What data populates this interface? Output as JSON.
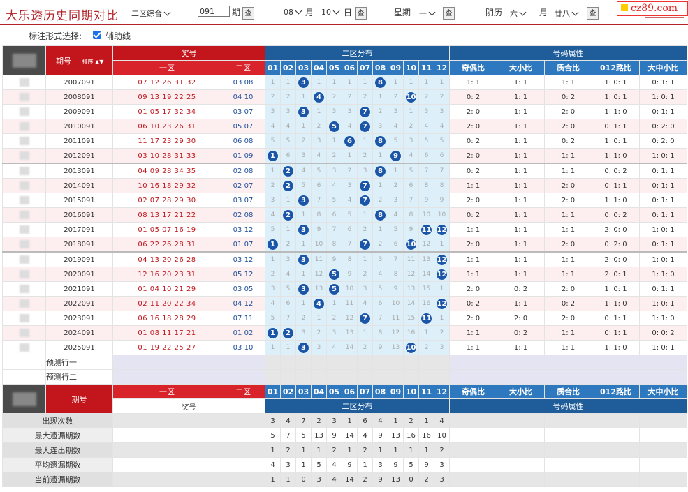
{
  "title": "大乐透历史同期对比",
  "controls": {
    "zone_select": "二区综合",
    "period_value": "091",
    "period_label": "期",
    "query_label": "查",
    "month_value": "08",
    "month_label": "月",
    "day_value": "10",
    "day_label": "日",
    "week_prefix": "星期",
    "week_value": "一",
    "lunar_prefix": "阴历",
    "lunar_month": "六",
    "lunar_month_label": "月",
    "lunar_day": "廿八"
  },
  "logo_text": "cz89.com",
  "options": {
    "label": "标注形式选择:",
    "checkbox_label": "辅助线",
    "checked": true
  },
  "header": {
    "issue": "期号",
    "sort": "排序",
    "prize": "奖号",
    "zone1": "一区",
    "zone2": "二区",
    "dist": "二区分布",
    "attr": "号码属性",
    "nums": [
      "01",
      "02",
      "03",
      "04",
      "05",
      "06",
      "07",
      "08",
      "09",
      "10",
      "11",
      "12"
    ],
    "attrs": [
      "奇偶比",
      "大小比",
      "质合比",
      "012路比",
      "大中小比"
    ]
  },
  "rows": [
    {
      "issue": "2007091",
      "z1": "07 12 26 31 32",
      "z2": "03 08",
      "dist": [
        "1",
        "1",
        "03",
        "1",
        "1",
        "1",
        "1",
        "08",
        "1",
        "1",
        "1",
        "1"
      ],
      "attr": [
        "1: 1",
        "1: 1",
        "1: 1",
        "1: 0: 1",
        "0: 1: 1"
      ]
    },
    {
      "issue": "2008091",
      "z1": "09 13 19 22 25",
      "z2": "04 10",
      "dist": [
        "2",
        "2",
        "1",
        "04",
        "2",
        "2",
        "2",
        "1",
        "2",
        "10",
        "2",
        "2"
      ],
      "attr": [
        "0: 2",
        "1: 1",
        "0: 2",
        "1: 0: 1",
        "1: 0: 1"
      ]
    },
    {
      "issue": "2009091",
      "z1": "01 05 17 32 34",
      "z2": "03 07",
      "dist": [
        "3",
        "3",
        "03",
        "1",
        "3",
        "3",
        "07",
        "2",
        "3",
        "1",
        "3",
        "3"
      ],
      "attr": [
        "2: 0",
        "1: 1",
        "2: 0",
        "1: 1: 0",
        "0: 1: 1"
      ]
    },
    {
      "issue": "2010091",
      "z1": "06 10 23 26 31",
      "z2": "05 07",
      "dist": [
        "4",
        "4",
        "1",
        "2",
        "05",
        "4",
        "07",
        "3",
        "4",
        "2",
        "4",
        "4"
      ],
      "attr": [
        "2: 0",
        "1: 1",
        "2: 0",
        "0: 1: 1",
        "0: 2: 0"
      ]
    },
    {
      "issue": "2011091",
      "z1": "11 17 23 29 30",
      "z2": "06 08",
      "dist": [
        "5",
        "5",
        "2",
        "3",
        "1",
        "06",
        "1",
        "08",
        "5",
        "3",
        "5",
        "5"
      ],
      "attr": [
        "0: 2",
        "1: 1",
        "0: 2",
        "1: 0: 1",
        "0: 2: 0"
      ]
    },
    {
      "issue": "2012091",
      "z1": "03 10 28 31 33",
      "z2": "01 09",
      "dist": [
        "01",
        "6",
        "3",
        "4",
        "2",
        "1",
        "2",
        "1",
        "09",
        "4",
        "6",
        "6"
      ],
      "attr": [
        "2: 0",
        "1: 1",
        "1: 1",
        "1: 1: 0",
        "1: 0: 1"
      ]
    },
    {
      "issue": "2013091",
      "z1": "04 09 28 34 35",
      "z2": "02 08",
      "dist": [
        "1",
        "02",
        "4",
        "5",
        "3",
        "2",
        "3",
        "08",
        "1",
        "5",
        "7",
        "7"
      ],
      "attr": [
        "0: 2",
        "1: 1",
        "1: 1",
        "0: 0: 2",
        "0: 1: 1"
      ]
    },
    {
      "issue": "2014091",
      "z1": "10 16 18 29 32",
      "z2": "02 07",
      "dist": [
        "2",
        "02",
        "5",
        "6",
        "4",
        "3",
        "07",
        "1",
        "2",
        "6",
        "8",
        "8"
      ],
      "attr": [
        "1: 1",
        "1: 1",
        "2: 0",
        "0: 1: 1",
        "0: 1: 1"
      ]
    },
    {
      "issue": "2015091",
      "z1": "02 07 28 29 30",
      "z2": "03 07",
      "dist": [
        "3",
        "1",
        "03",
        "7",
        "5",
        "4",
        "07",
        "2",
        "3",
        "7",
        "9",
        "9"
      ],
      "attr": [
        "2: 0",
        "1: 1",
        "2: 0",
        "1: 1: 0",
        "0: 1: 1"
      ]
    },
    {
      "issue": "2016091",
      "z1": "08 13 17 21 22",
      "z2": "02 08",
      "dist": [
        "4",
        "02",
        "1",
        "8",
        "6",
        "5",
        "1",
        "08",
        "4",
        "8",
        "10",
        "10"
      ],
      "attr": [
        "0: 2",
        "1: 1",
        "1: 1",
        "0: 0: 2",
        "0: 1: 1"
      ]
    },
    {
      "issue": "2017091",
      "z1": "01 05 07 16 19",
      "z2": "03 12",
      "dist": [
        "5",
        "1",
        "03",
        "9",
        "7",
        "6",
        "2",
        "1",
        "5",
        "9",
        "11",
        "12"
      ],
      "attr": [
        "1: 1",
        "1: 1",
        "1: 1",
        "2: 0: 0",
        "1: 0: 1"
      ]
    },
    {
      "issue": "2018091",
      "z1": "06 22 26 28 31",
      "z2": "01 07",
      "dist": [
        "01",
        "2",
        "1",
        "10",
        "8",
        "7",
        "07",
        "2",
        "6",
        "10",
        "12",
        "1"
      ],
      "attr": [
        "2: 0",
        "1: 1",
        "2: 0",
        "0: 2: 0",
        "0: 1: 1"
      ]
    },
    {
      "issue": "2019091",
      "z1": "04 13 20 26 28",
      "z2": "03 12",
      "dist": [
        "1",
        "3",
        "03",
        "11",
        "9",
        "8",
        "1",
        "3",
        "7",
        "11",
        "13",
        "12"
      ],
      "attr": [
        "1: 1",
        "1: 1",
        "1: 1",
        "2: 0: 0",
        "1: 0: 1"
      ]
    },
    {
      "issue": "2020091",
      "z1": "12 16 20 23 31",
      "z2": "05 12",
      "dist": [
        "2",
        "4",
        "1",
        "12",
        "05",
        "9",
        "2",
        "4",
        "8",
        "12",
        "14",
        "12"
      ],
      "attr": [
        "1: 1",
        "1: 1",
        "1: 1",
        "2: 0: 1",
        "1: 1: 0"
      ]
    },
    {
      "issue": "2021091",
      "z1": "01 04 10 21 29",
      "z2": "03 05",
      "dist": [
        "3",
        "5",
        "03",
        "13",
        "05",
        "10",
        "3",
        "5",
        "9",
        "13",
        "15",
        "1"
      ],
      "attr": [
        "2: 0",
        "0: 2",
        "2: 0",
        "1: 0: 1",
        "0: 1: 1"
      ]
    },
    {
      "issue": "2022091",
      "z1": "02 11 20 22 34",
      "z2": "04 12",
      "dist": [
        "4",
        "6",
        "1",
        "04",
        "1",
        "11",
        "4",
        "6",
        "10",
        "14",
        "16",
        "12"
      ],
      "attr": [
        "0: 2",
        "1: 1",
        "0: 2",
        "1: 1: 0",
        "1: 0: 1"
      ]
    },
    {
      "issue": "2023091",
      "z1": "06 16 18 28 29",
      "z2": "07 11",
      "dist": [
        "5",
        "7",
        "2",
        "1",
        "2",
        "12",
        "07",
        "7",
        "11",
        "15",
        "11",
        "1"
      ],
      "attr": [
        "2: 0",
        "2: 0",
        "2: 0",
        "0: 1: 1",
        "1: 1: 0"
      ]
    },
    {
      "issue": "2024091",
      "z1": "01 08 11 17 21",
      "z2": "01 02",
      "dist": [
        "01",
        "02",
        "3",
        "2",
        "3",
        "13",
        "1",
        "8",
        "12",
        "16",
        "1",
        "2"
      ],
      "attr": [
        "1: 1",
        "0: 2",
        "1: 1",
        "0: 1: 1",
        "0: 0: 2"
      ]
    },
    {
      "issue": "2025091",
      "z1": "01 19 22 25 27",
      "z2": "03 10",
      "dist": [
        "1",
        "1",
        "03",
        "3",
        "4",
        "14",
        "2",
        "9",
        "13",
        "10",
        "2",
        "3"
      ],
      "attr": [
        "1: 1",
        "1: 1",
        "1: 1",
        "1: 1: 0",
        "1: 0: 1"
      ]
    }
  ],
  "predict": [
    "预测行一",
    "预测行二"
  ],
  "stats": [
    {
      "label": "出现次数",
      "vals": [
        "3",
        "4",
        "7",
        "2",
        "3",
        "1",
        "6",
        "4",
        "1",
        "2",
        "1",
        "4"
      ]
    },
    {
      "label": "最大遗漏期数",
      "vals": [
        "5",
        "7",
        "5",
        "13",
        "9",
        "14",
        "4",
        "9",
        "13",
        "16",
        "16",
        "10"
      ]
    },
    {
      "label": "最大连出期数",
      "vals": [
        "1",
        "2",
        "1",
        "1",
        "2",
        "1",
        "2",
        "1",
        "1",
        "1",
        "1",
        "2"
      ]
    },
    {
      "label": "平均遗漏期数",
      "vals": [
        "4",
        "3",
        "1",
        "5",
        "4",
        "9",
        "1",
        "3",
        "9",
        "5",
        "9",
        "3"
      ]
    },
    {
      "label": "当前遗漏期数",
      "vals": [
        "1",
        "1",
        "0",
        "3",
        "4",
        "14",
        "2",
        "9",
        "13",
        "0",
        "2",
        "3"
      ]
    }
  ]
}
